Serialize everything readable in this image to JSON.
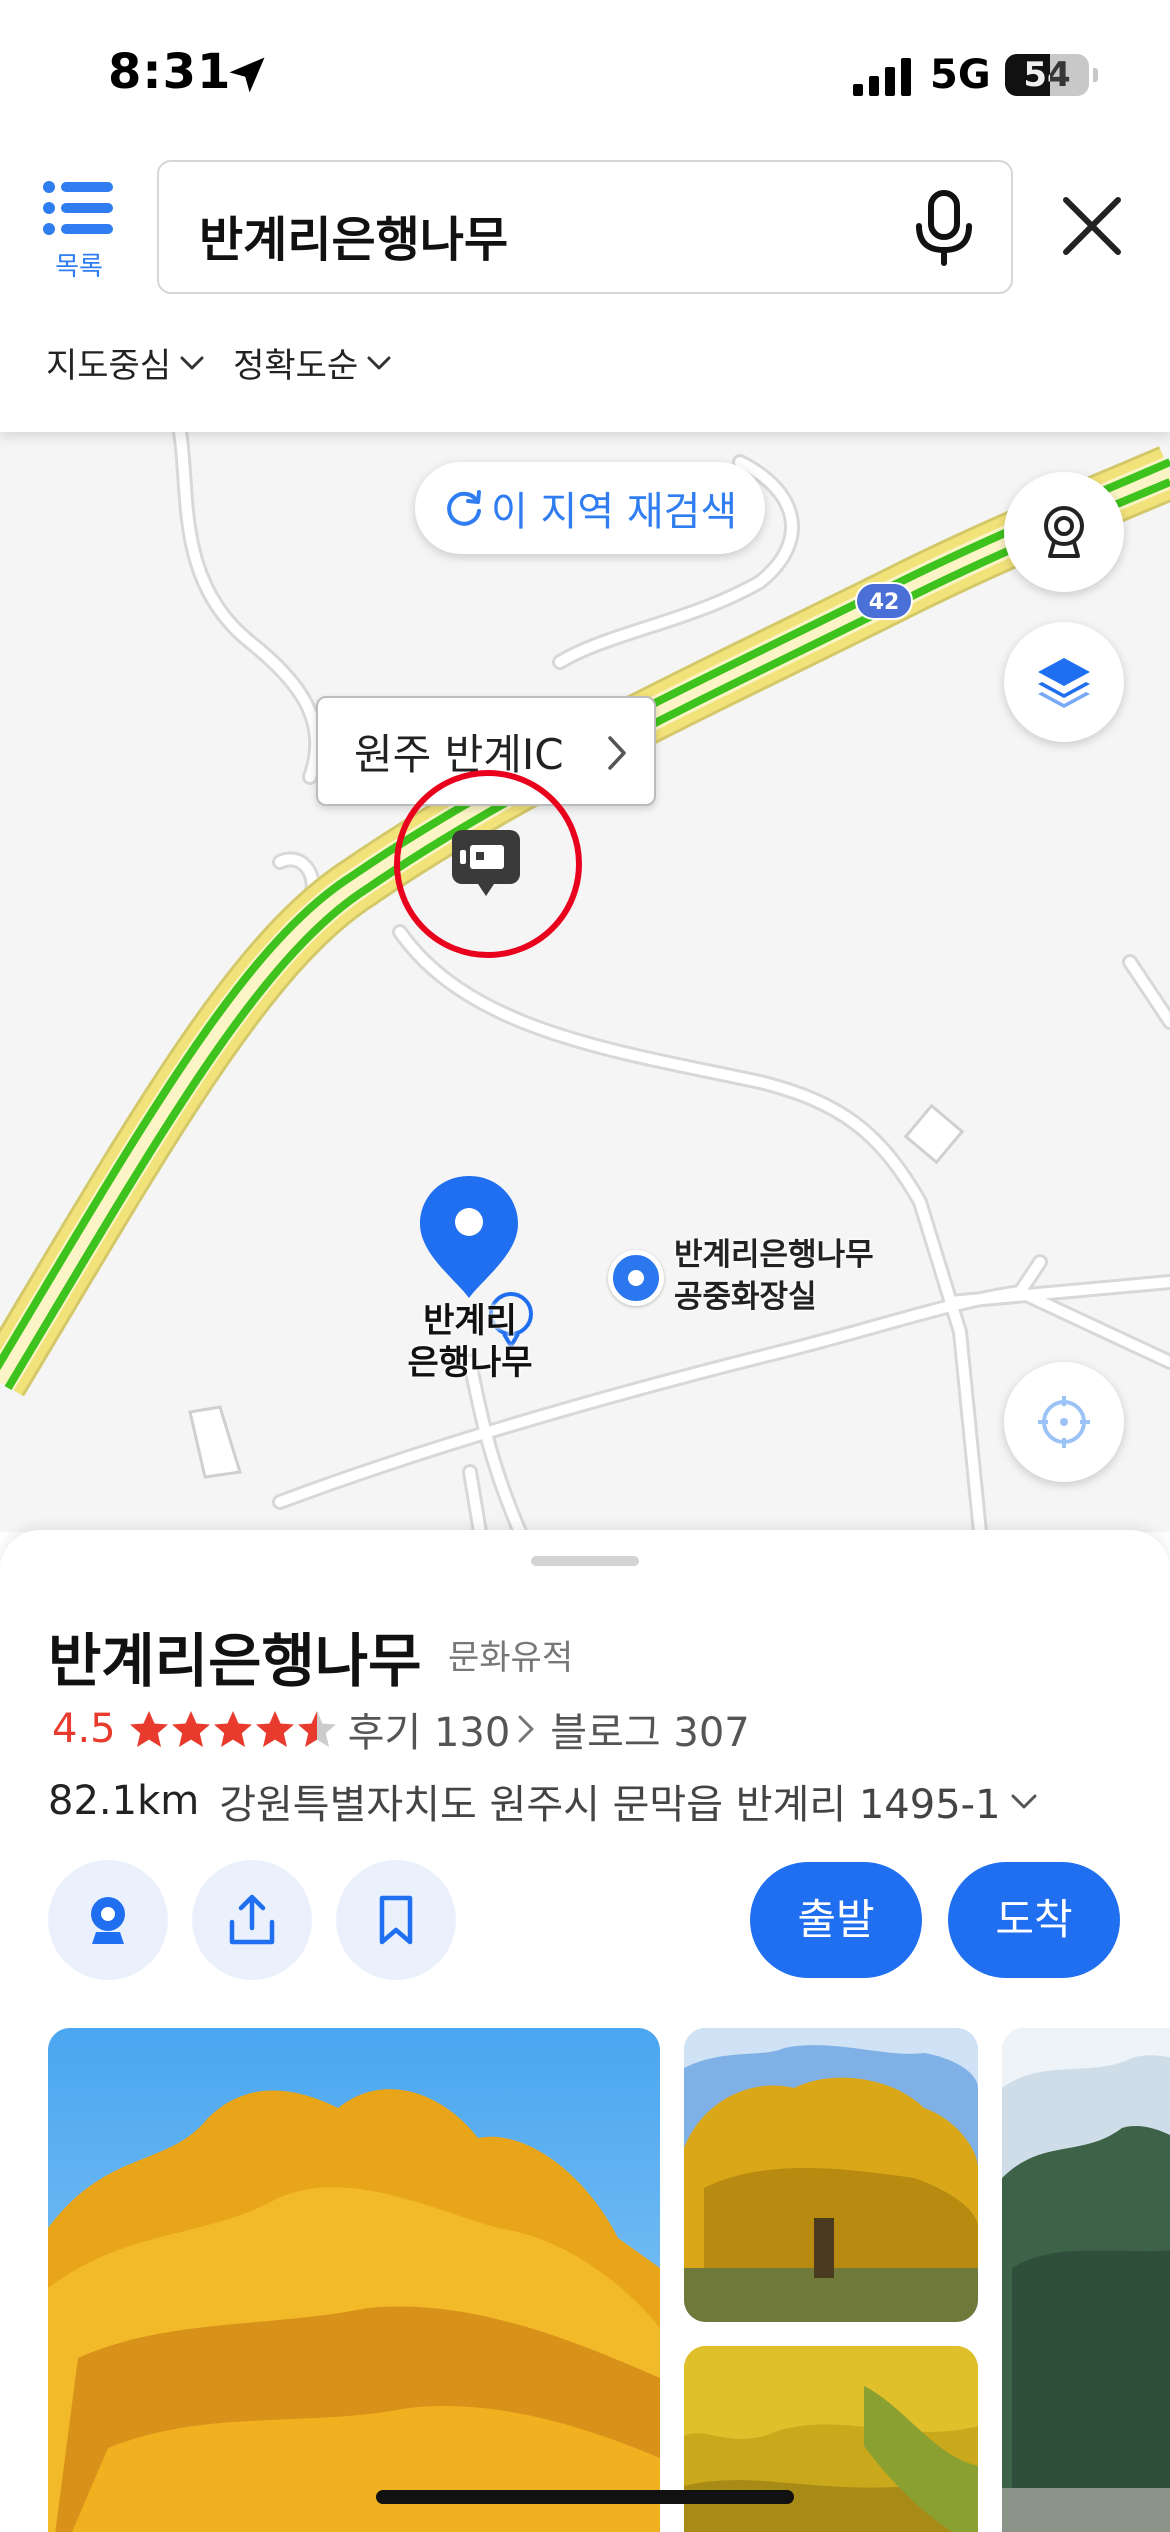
{
  "status_bar": {
    "time": "8:31",
    "network": "5G",
    "battery": "54"
  },
  "header": {
    "list_label": "목록",
    "search_value": "반계리은행나무",
    "filters": [
      {
        "label": "지도중심"
      },
      {
        "label": "정확도순"
      }
    ]
  },
  "map": {
    "research_label": "이 지역 재검색",
    "callout_label": "원주 반계IC",
    "route_number": "42",
    "pin_label_line1": "반계리",
    "pin_label_line2": "은행나무",
    "poi_line1": "반계리은행나무",
    "poi_line2": "공중화장실"
  },
  "place": {
    "title": "반계리은행나무",
    "category": "문화유적",
    "rating": "4.5",
    "rating_value": 4.5,
    "reviews": "후기 130",
    "blogs": "블로그 307",
    "distance": "82.1km",
    "address": "강원특별자치도 원주시 문막읍 반계리 1495-1",
    "depart_label": "출발",
    "arrive_label": "도착"
  },
  "colors": {
    "accent": "#1f6ff0",
    "rating": "#e83b2e",
    "route_green": "#3ec21d",
    "route_yellow": "#f2e27a",
    "marker_red": "#e8001c"
  }
}
